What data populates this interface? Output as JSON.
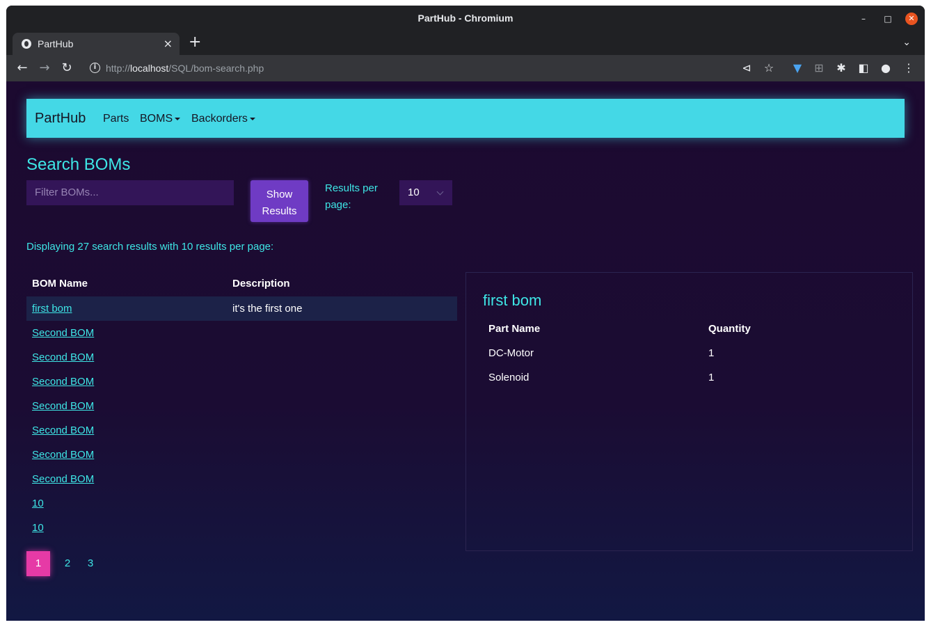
{
  "browser": {
    "window_title": "PartHub - Chromium",
    "tab_title": "PartHub",
    "url_prefix": "http://",
    "url_host": "localhost",
    "url_path": "/SQL/bom-search.php"
  },
  "navbar": {
    "brand": "PartHub",
    "links": [
      {
        "label": "Parts"
      },
      {
        "label": "BOMS"
      },
      {
        "label": "Backorders"
      }
    ]
  },
  "search": {
    "heading": "Search BOMs",
    "placeholder": "Filter BOMs...",
    "show_line1": "Show",
    "show_line2": "Results",
    "rpp_label": "Results per page:",
    "rpp_value": "10"
  },
  "summary": "Displaying 27 search results with 10 results per page:",
  "results": {
    "headers": [
      "BOM Name",
      "Description"
    ],
    "rows": [
      {
        "name": "first bom",
        "description": "it's the first one"
      },
      {
        "name": "Second BOM",
        "description": ""
      },
      {
        "name": "Second BOM",
        "description": ""
      },
      {
        "name": "Second BOM",
        "description": ""
      },
      {
        "name": "Second BOM",
        "description": ""
      },
      {
        "name": "Second BOM",
        "description": ""
      },
      {
        "name": "Second BOM",
        "description": ""
      },
      {
        "name": "Second BOM",
        "description": ""
      },
      {
        "name": "10",
        "description": ""
      },
      {
        "name": "10",
        "description": ""
      }
    ]
  },
  "pagination": [
    "1",
    "2",
    "3"
  ],
  "detail": {
    "title": "first bom",
    "headers": [
      "Part Name",
      "Quantity"
    ],
    "rows": [
      {
        "part": "DC-Motor",
        "qty": "1"
      },
      {
        "part": "Solenoid",
        "qty": "1"
      }
    ]
  },
  "colors": {
    "accent": "#3ee6e6",
    "navbar": "#44d8e6",
    "button": "#6f3bc4",
    "page_active": "#e63aa6"
  }
}
